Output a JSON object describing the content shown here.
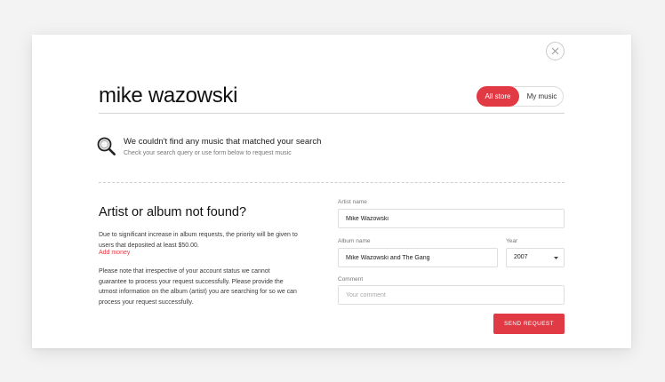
{
  "search": {
    "query": "mike wazowski",
    "scope_options": [
      "All store",
      "My music"
    ],
    "active_scope": "All store"
  },
  "notice": {
    "icon": "magnifier-icon",
    "title": "We couldn't find any music that matched your search",
    "subtitle": "Check your search query or use form below to request music"
  },
  "request_info": {
    "title": "Artist or album not found?",
    "paragraph1": "Due to significant increase in album requests, the priority will be given to users that deposited at least $50.00.",
    "add_money_link": "Add money",
    "paragraph2": "Please note that irrespective of your account status we cannot guarantee to process your request successfully. Please provide the utmost information on the album (artist) you are searching for so we can process your request successfully."
  },
  "form": {
    "artist_label": "Artist name",
    "artist_value": "Mike Wazowski",
    "album_label": "Album name",
    "album_value": "Mike Wazowski and The Gang",
    "year_label": "Year",
    "year_value": "2007",
    "comment_label": "Comment",
    "comment_placeholder": "Your comment",
    "submit_label": "SEND REQUEST"
  },
  "colors": {
    "accent": "#e23a44",
    "background": "#f3f3f4",
    "card": "#ffffff"
  }
}
